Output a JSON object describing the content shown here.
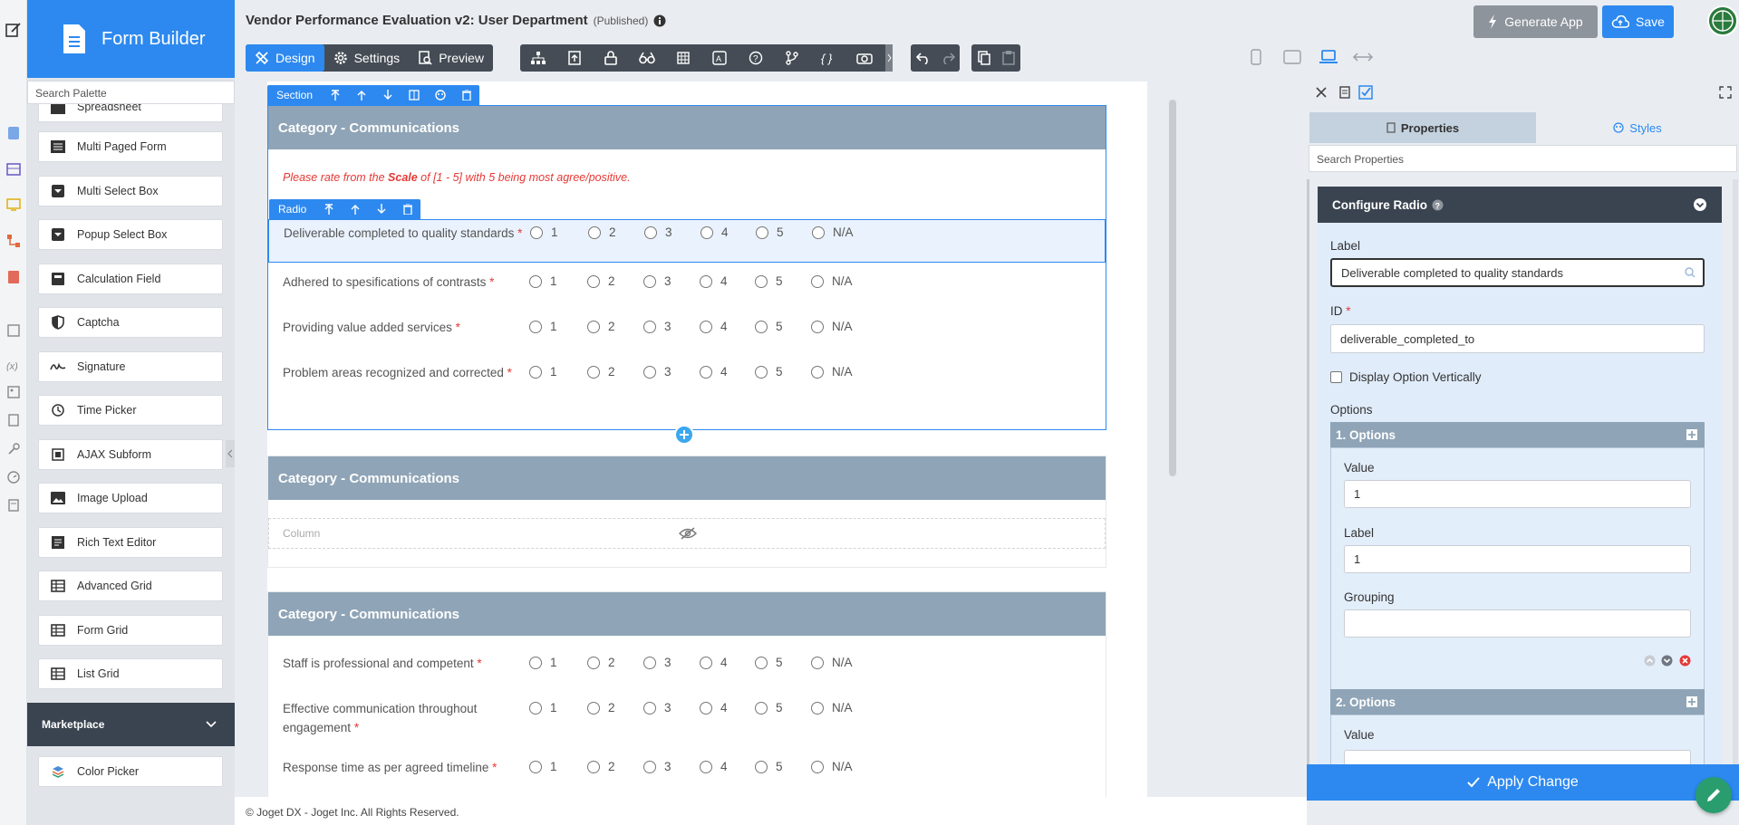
{
  "app": {
    "title": "Vendor Performance Evaluation v2: User Department",
    "status": "(Published)",
    "generate_label": "Generate App",
    "save_label": "Save",
    "accent": "#2d89ef"
  },
  "palette": {
    "brand": "Form Builder",
    "search_placeholder": "Search Palette",
    "partial_item": "Spreadsheet",
    "items": [
      {
        "label": "Multi Paged Form",
        "icon": "multi-paged-form-icon"
      },
      {
        "label": "Multi Select Box",
        "icon": "multi-select-icon"
      },
      {
        "label": "Popup Select Box",
        "icon": "popup-select-icon"
      },
      {
        "label": "Calculation Field",
        "icon": "calculator-icon"
      },
      {
        "label": "Captcha",
        "icon": "shield-icon"
      },
      {
        "label": "Signature",
        "icon": "signature-icon"
      },
      {
        "label": "Time Picker",
        "icon": "clock-icon"
      },
      {
        "label": "AJAX Subform",
        "icon": "subform-icon"
      },
      {
        "label": "Image Upload",
        "icon": "image-icon"
      },
      {
        "label": "Rich Text Editor",
        "icon": "rich-text-icon"
      },
      {
        "label": "Advanced Grid",
        "icon": "grid-icon"
      },
      {
        "label": "Form Grid",
        "icon": "grid-icon"
      },
      {
        "label": "List Grid",
        "icon": "grid-icon"
      }
    ],
    "marketplace": "Marketplace",
    "marketplace_item": "Color Picker"
  },
  "toolbar": {
    "design": "Design",
    "settings": "Settings",
    "preview": "Preview"
  },
  "form": {
    "section_toolbar_label": "Section",
    "radio_toolbar_label": "Radio",
    "instruction_prefix": "Please rate from the ",
    "instruction_bold": "Scale",
    "instruction_suffix": " of [1 - 5] with 5 being most agree/positive.",
    "options": [
      "1",
      "2",
      "3",
      "4",
      "5",
      "N/A"
    ],
    "required_mark": "*",
    "sections": [
      {
        "title": "Category - Communications",
        "questions": [
          "Deliverable completed to quality standards",
          "Adhered to spesifications of contrasts",
          "Providing value added services",
          "Problem areas recognized and corrected"
        ]
      },
      {
        "title": "Category - Communications",
        "column_label": "Column"
      },
      {
        "title": "Category - Communications",
        "questions": [
          "Staff is professional and competent",
          "Effective communication throughout engagement",
          "Response time as per agreed timeline"
        ]
      }
    ]
  },
  "footer": "© Joget DX - Joget Inc. All Rights Reserved.",
  "properties": {
    "tab_properties": "Properties",
    "tab_styles": "Styles",
    "search_placeholder": "Search Properties",
    "config_title": "Configure Radio",
    "label_label": "Label",
    "label_value": "Deliverable completed to quality standards",
    "id_label": "ID",
    "id_value": "deliverable_completed_to",
    "vertical_label": "Display Option Vertically",
    "options_label": "Options",
    "option1_title": "1. Options",
    "value_label": "Value",
    "value1": "1",
    "opt_label_label": "Label",
    "label1": "1",
    "grouping_label": "Grouping",
    "grouping1": "",
    "option2_title": "2. Options",
    "value_label2": "Value",
    "apply": "Apply Change"
  }
}
